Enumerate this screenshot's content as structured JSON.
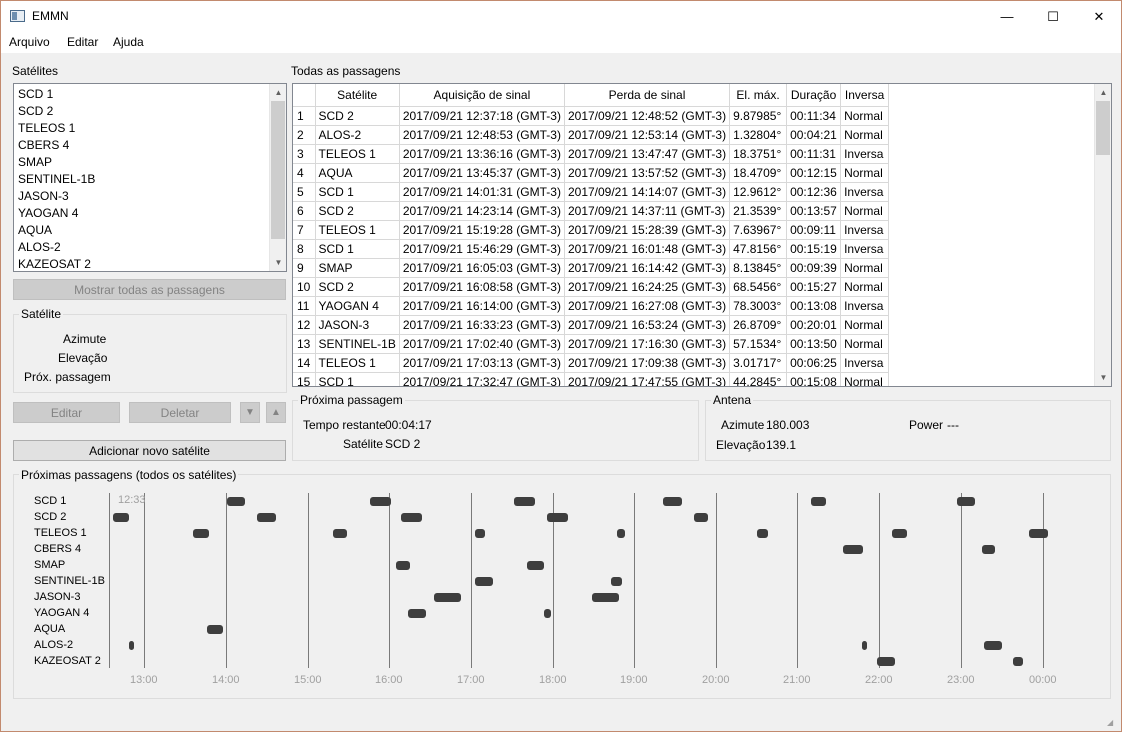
{
  "window": {
    "title": "EMMN",
    "minimize_glyph": "—",
    "maximize_glyph": "☐",
    "close_glyph": "✕"
  },
  "menu": [
    "Arquivo",
    "Editar",
    "Ajuda"
  ],
  "satellites_panel": {
    "title": "Satélites",
    "items": [
      "SCD 1",
      "SCD 2",
      "TELEOS 1",
      "CBERS 4",
      "SMAP",
      "SENTINEL-1B",
      "JASON-3",
      "YAOGAN 4",
      "AQUA",
      "ALOS-2",
      "KAZEOSAT 2"
    ],
    "show_all_button": "Mostrar todas as passagens"
  },
  "satellite_group": {
    "title": "Satélite",
    "azimuth_label": "Azimute",
    "elevation_label": "Elevação",
    "next_pass_label": "Próx. passagem"
  },
  "actions": {
    "edit_button": "Editar",
    "delete_button": "Deletar",
    "move_down_glyph": "▼",
    "move_up_glyph": "▲",
    "add_button": "Adicionar novo satélite"
  },
  "passes": {
    "title": "Todas as passagens",
    "columns": [
      "Satélite",
      "Aquisição de sinal",
      "Perda de sinal",
      "El. máx.",
      "Duração",
      "Inversa"
    ],
    "rows": [
      [
        "1",
        "SCD 2",
        "2017/09/21 12:37:18 (GMT-3)",
        "2017/09/21 12:48:52 (GMT-3)",
        "9.87985°",
        "00:11:34",
        "Normal"
      ],
      [
        "2",
        "ALOS-2",
        "2017/09/21 12:48:53 (GMT-3)",
        "2017/09/21 12:53:14 (GMT-3)",
        "1.32804°",
        "00:04:21",
        "Normal"
      ],
      [
        "3",
        "TELEOS 1",
        "2017/09/21 13:36:16 (GMT-3)",
        "2017/09/21 13:47:47 (GMT-3)",
        "18.3751°",
        "00:11:31",
        "Inversa"
      ],
      [
        "4",
        "AQUA",
        "2017/09/21 13:45:37 (GMT-3)",
        "2017/09/21 13:57:52 (GMT-3)",
        "18.4709°",
        "00:12:15",
        "Normal"
      ],
      [
        "5",
        "SCD 1",
        "2017/09/21 14:01:31 (GMT-3)",
        "2017/09/21 14:14:07 (GMT-3)",
        "12.9612°",
        "00:12:36",
        "Inversa"
      ],
      [
        "6",
        "SCD 2",
        "2017/09/21 14:23:14 (GMT-3)",
        "2017/09/21 14:37:11 (GMT-3)",
        "21.3539°",
        "00:13:57",
        "Normal"
      ],
      [
        "7",
        "TELEOS 1",
        "2017/09/21 15:19:28 (GMT-3)",
        "2017/09/21 15:28:39 (GMT-3)",
        "7.63967°",
        "00:09:11",
        "Inversa"
      ],
      [
        "8",
        "SCD 1",
        "2017/09/21 15:46:29 (GMT-3)",
        "2017/09/21 16:01:48 (GMT-3)",
        "47.8156°",
        "00:15:19",
        "Inversa"
      ],
      [
        "9",
        "SMAP",
        "2017/09/21 16:05:03 (GMT-3)",
        "2017/09/21 16:14:42 (GMT-3)",
        "8.13845°",
        "00:09:39",
        "Normal"
      ],
      [
        "10",
        "SCD 2",
        "2017/09/21 16:08:58 (GMT-3)",
        "2017/09/21 16:24:25 (GMT-3)",
        "68.5456°",
        "00:15:27",
        "Normal"
      ],
      [
        "11",
        "YAOGAN 4",
        "2017/09/21 16:14:00 (GMT-3)",
        "2017/09/21 16:27:08 (GMT-3)",
        "78.3003°",
        "00:13:08",
        "Inversa"
      ],
      [
        "12",
        "JASON-3",
        "2017/09/21 16:33:23 (GMT-3)",
        "2017/09/21 16:53:24 (GMT-3)",
        "26.8709°",
        "00:20:01",
        "Normal"
      ],
      [
        "13",
        "SENTINEL-1B",
        "2017/09/21 17:02:40 (GMT-3)",
        "2017/09/21 17:16:30 (GMT-3)",
        "57.1534°",
        "00:13:50",
        "Normal"
      ],
      [
        "14",
        "TELEOS 1",
        "2017/09/21 17:03:13 (GMT-3)",
        "2017/09/21 17:09:38 (GMT-3)",
        "3.01717°",
        "00:06:25",
        "Inversa"
      ],
      [
        "15",
        "SCD 1",
        "2017/09/21 17:32:47 (GMT-3)",
        "2017/09/21 17:47:55 (GMT-3)",
        "44.2845°",
        "00:15:08",
        "Normal"
      ]
    ]
  },
  "next_pass": {
    "title": "Próxima passagem",
    "remaining_label": "Tempo restante",
    "remaining_value": "00:04:17",
    "satellite_label": "Satélite",
    "satellite_value": "SCD 2"
  },
  "antenna": {
    "title": "Antena",
    "azimuth_label": "Azimute",
    "azimuth_value": "180.003",
    "elevation_label": "Elevação",
    "elevation_value": "139.1",
    "power_label": "Power",
    "power_value": "---"
  },
  "timeline": {
    "title": "Próximas passagens (todos os satélites)",
    "current_time": "12:33",
    "satellites": [
      "SCD 1",
      "SCD 2",
      "TELEOS 1",
      "CBERS 4",
      "SMAP",
      "SENTINEL-1B",
      "JASON-3",
      "YAOGAN 4",
      "AQUA",
      "ALOS-2",
      "KAZEOSAT 2"
    ],
    "hours": [
      "13:00",
      "14:00",
      "15:00",
      "16:00",
      "17:00",
      "18:00",
      "19:00",
      "20:00",
      "21:00",
      "22:00",
      "23:00",
      "00:00"
    ],
    "start_time": "12:33",
    "passes": [
      {
        "sat": 0,
        "start": "14:01",
        "end": "14:14"
      },
      {
        "sat": 0,
        "start": "15:46",
        "end": "16:01"
      },
      {
        "sat": 0,
        "start": "17:32",
        "end": "17:47"
      },
      {
        "sat": 0,
        "start": "19:21",
        "end": "19:35"
      },
      {
        "sat": 0,
        "start": "21:10",
        "end": "21:21"
      },
      {
        "sat": 0,
        "start": "22:57",
        "end": "23:10"
      },
      {
        "sat": 1,
        "start": "12:37",
        "end": "12:49"
      },
      {
        "sat": 1,
        "start": "14:23",
        "end": "14:37"
      },
      {
        "sat": 1,
        "start": "16:09",
        "end": "16:24"
      },
      {
        "sat": 1,
        "start": "17:56",
        "end": "18:11"
      },
      {
        "sat": 1,
        "start": "19:44",
        "end": "19:54"
      },
      {
        "sat": 2,
        "start": "13:36",
        "end": "13:48"
      },
      {
        "sat": 2,
        "start": "15:19",
        "end": "15:29"
      },
      {
        "sat": 2,
        "start": "17:03",
        "end": "17:10"
      },
      {
        "sat": 2,
        "start": "18:47",
        "end": "18:53"
      },
      {
        "sat": 2,
        "start": "20:30",
        "end": "20:38"
      },
      {
        "sat": 2,
        "start": "22:09",
        "end": "22:20"
      },
      {
        "sat": 2,
        "start": "23:50",
        "end": "00:04"
      },
      {
        "sat": 3,
        "start": "21:33",
        "end": "21:48"
      },
      {
        "sat": 3,
        "start": "23:15",
        "end": "23:25"
      },
      {
        "sat": 4,
        "start": "16:05",
        "end": "16:15"
      },
      {
        "sat": 4,
        "start": "17:41",
        "end": "17:54"
      },
      {
        "sat": 5,
        "start": "17:03",
        "end": "17:16"
      },
      {
        "sat": 5,
        "start": "18:43",
        "end": "18:51"
      },
      {
        "sat": 6,
        "start": "16:33",
        "end": "16:53"
      },
      {
        "sat": 6,
        "start": "18:29",
        "end": "18:49"
      },
      {
        "sat": 7,
        "start": "16:14",
        "end": "16:27"
      },
      {
        "sat": 7,
        "start": "17:54",
        "end": "17:59"
      },
      {
        "sat": 8,
        "start": "13:46",
        "end": "13:58"
      },
      {
        "sat": 9,
        "start": "12:49",
        "end": "12:53"
      },
      {
        "sat": 9,
        "start": "21:47",
        "end": "21:50"
      },
      {
        "sat": 9,
        "start": "23:17",
        "end": "23:30"
      },
      {
        "sat": 10,
        "start": "21:58",
        "end": "22:11"
      },
      {
        "sat": 10,
        "start": "23:38",
        "end": "23:45"
      }
    ]
  }
}
